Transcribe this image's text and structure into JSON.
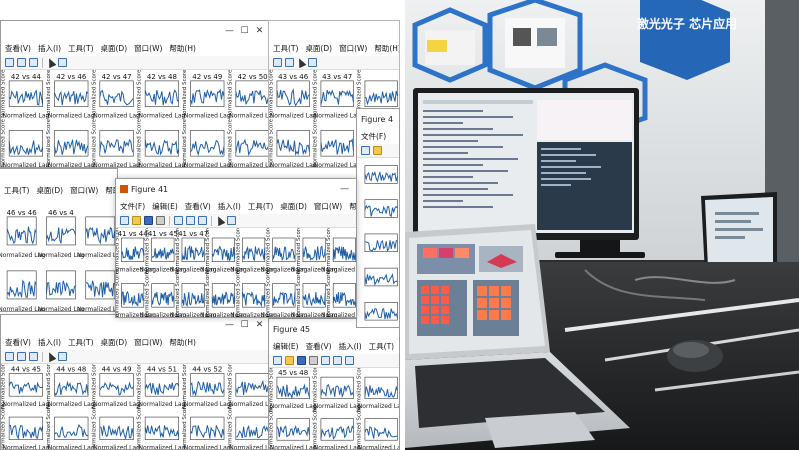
{
  "menu": {
    "view": "查看(V)",
    "insert": "插入(I)",
    "tools": "工具(T)",
    "desktop": "桌面(D)",
    "window": "窗口(W)",
    "help": "帮助(H)",
    "file": "文件(F)",
    "edit": "编辑(E)"
  },
  "figures": {
    "fig44": {
      "subplot_titles": [
        "42 vs 44",
        "42 vs 46",
        "42 vs 47",
        "42 vs 48",
        "42 vs 49",
        "42 vs 50"
      ],
      "xlabel": "Normalized Lag",
      "ylabel": "Normalized Score"
    },
    "fig43": {
      "subplot_titles": [
        "43 vs 46",
        "43 vs 47"
      ],
      "xlabel": "Normalized Lag",
      "ylabel": "Normalized Score"
    },
    "figwide": {
      "subplot_titles": [
        "46 vs 46",
        "46 vs 4"
      ],
      "xlabel": "Normalized Lag"
    },
    "fig41": {
      "title": "Figure 41",
      "subplot_titles": [
        "41 vs 44",
        "41 vs 45",
        "41 vs 47"
      ],
      "xlabel": "Normalized Lag",
      "ylabel": "Normalized Score"
    },
    "figR": {
      "title": "Figure 4"
    },
    "fig44b": {
      "subplot_titles": [
        "44 vs 45",
        "44 vs 48",
        "44 vs 49",
        "44 vs 51",
        "44 vs 52"
      ],
      "xlabel": "Normalized Lag",
      "ylabel": "Normalized Score"
    },
    "fig45": {
      "title": "Figure 45",
      "subplot_titles": [
        "45 vs 48"
      ],
      "xlabel": "Normalized Lag",
      "ylabel": "Normalized Score"
    }
  },
  "photo": {
    "wall_sign": "激光光子 芯片应用"
  },
  "colors": {
    "plot_line": "#1f5fa8",
    "window_border": "#9a9a9a",
    "monitor_bg": "#e9ecef",
    "terminal_bg": "#2a3a4a"
  }
}
